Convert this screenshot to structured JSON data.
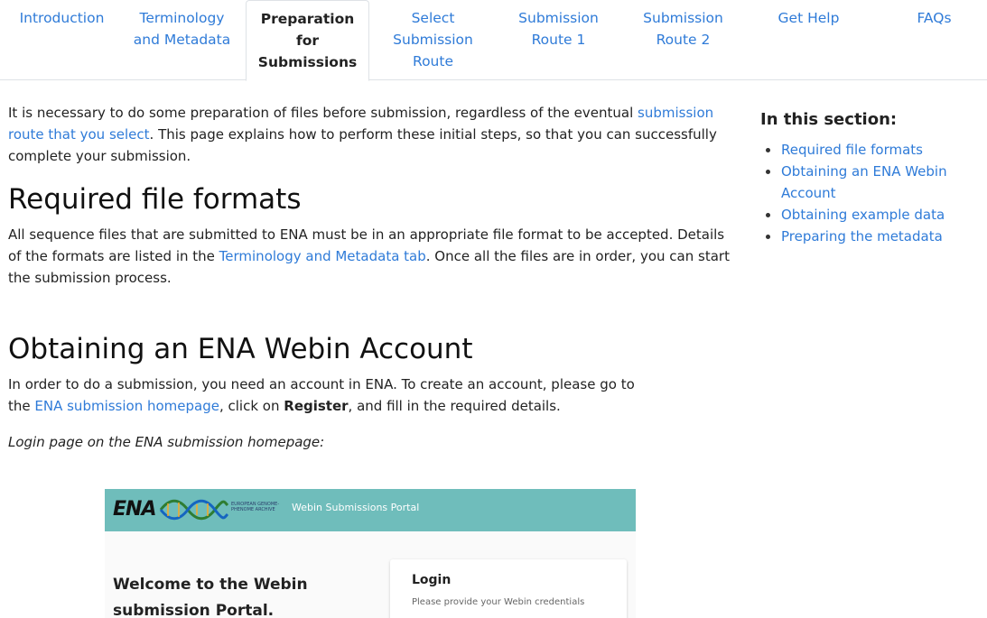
{
  "tabs": [
    {
      "label": "Introduction",
      "lines": [
        "Introduction"
      ],
      "active": false
    },
    {
      "label": "Terminology and Metadata",
      "lines": [
        "Terminology",
        "and Metadata"
      ],
      "active": false
    },
    {
      "label": "Preparation for Submissions",
      "lines": [
        "Preparation",
        "for",
        "Submissions"
      ],
      "active": true
    },
    {
      "label": "Select Submission Route",
      "lines": [
        "Select",
        "Submission",
        "Route"
      ],
      "active": false
    },
    {
      "label": "Submission Route 1",
      "lines": [
        "Submission",
        "Route 1"
      ],
      "active": false
    },
    {
      "label": "Submission Route 2",
      "lines": [
        "Submission",
        "Route 2"
      ],
      "active": false
    },
    {
      "label": "Get Help",
      "lines": [
        "Get Help"
      ],
      "active": false
    },
    {
      "label": "FAQs",
      "lines": [
        "FAQs"
      ],
      "active": false
    }
  ],
  "intro": {
    "text_before": "It is necessary to do some preparation of files before submission, regardless of the eventual ",
    "link": "submission route that you select",
    "text_after": ". This page explains how to perform these initial steps, so that you can successfully complete your submission."
  },
  "formats": {
    "heading": "Required file formats",
    "text_before": "All sequence files that are submitted to ENA must be in an appropriate file format to be accepted. Details of the formats are listed in the ",
    "link": "Terminology and Metadata tab",
    "text_after": ". Once all the files are in order, you can start the submission process."
  },
  "webin": {
    "heading": "Obtaining an ENA Webin Account",
    "text_before": "In order to do a submission, you need an account in ENA. To create an account, please go to the ",
    "link": "ENA submission homepage",
    "text_mid": ", click on ",
    "bold": "Register",
    "text_after": ", and fill in the required details.",
    "caption": "Login page on the ENA submission homepage:"
  },
  "screenshot": {
    "logo": "ENA",
    "ega_text": "EUROPEAN GENOME-PHENOME ARCHIVE",
    "portal_title": "Webin Submissions Portal",
    "welcome": "Welcome to the Webin submission Portal.",
    "login_title": "Login",
    "login_sub": "Please provide your Webin credentials",
    "bar_color": "#6fbdbb"
  },
  "toc": {
    "title": "In this section:",
    "items": [
      "Required file formats",
      "Obtaining an ENA Webin Account",
      "Obtaining example data",
      "Preparing the metadata"
    ]
  },
  "colors": {
    "link": "#2f7bd8",
    "text": "#222222"
  }
}
